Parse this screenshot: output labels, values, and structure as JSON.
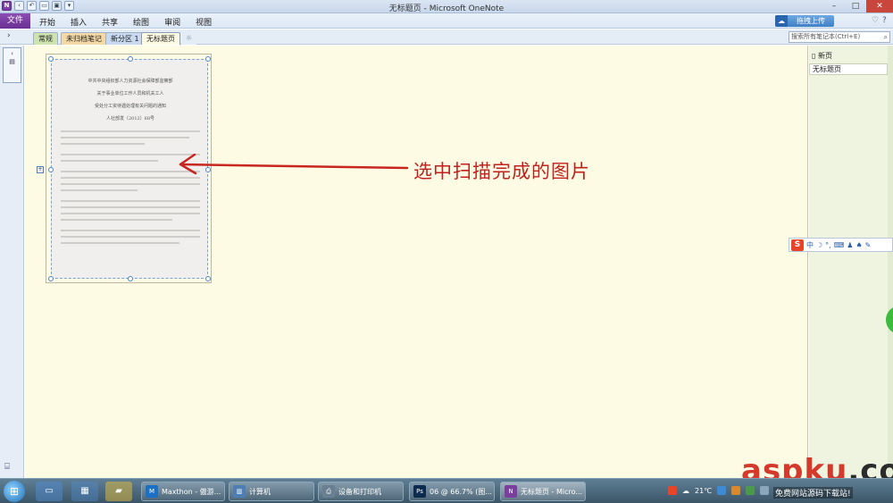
{
  "window": {
    "title": "无标题页 - Microsoft OneNote"
  },
  "ribbon": {
    "file_tab": "文件",
    "tabs": [
      "开始",
      "插入",
      "共享",
      "绘图",
      "审阅",
      "视图"
    ],
    "upload_label": "拖拽上传"
  },
  "sections": {
    "tabs": [
      "常规",
      "未归档笔记",
      "新分区 1",
      "无标题页"
    ],
    "active": "无标题页",
    "search_placeholder": "搜索所有笔记本(Ctrl+E)"
  },
  "pages_pane": {
    "new_page": "新页",
    "pages": [
      "无标题页"
    ]
  },
  "document_image": {
    "heading_lines": [
      "中共中央组织部人力资源社会保障部监察部",
      "关于事业单位工作人员和机关工人",
      "受处分工资待遇处理有关问题的通知",
      "人社部发〔2012〕68号"
    ]
  },
  "annotation": {
    "text": "选中扫描完成的图片"
  },
  "ime": {
    "label": "中"
  },
  "taskbar": {
    "tasks": [
      {
        "label": "Maxthon - 傲游...",
        "icon": "maxthon-icon"
      },
      {
        "label": "计算机",
        "icon": "computer-icon"
      },
      {
        "label": "设备和打印机",
        "icon": "printer-icon"
      },
      {
        "label": "06 @ 66.7% (图...",
        "icon": "photoshop-icon"
      },
      {
        "label": "无标题页 - Micro...",
        "icon": "onenote-icon"
      }
    ],
    "temperature": "21℃"
  },
  "watermark": {
    "main": "aspku",
    "suffix": ".com",
    "sub": "免费网站源码下载站!"
  },
  "colors": {
    "canvas": "#fdfbe3",
    "annotation": "#c0211e",
    "file_tab": "#7b3fa0"
  }
}
